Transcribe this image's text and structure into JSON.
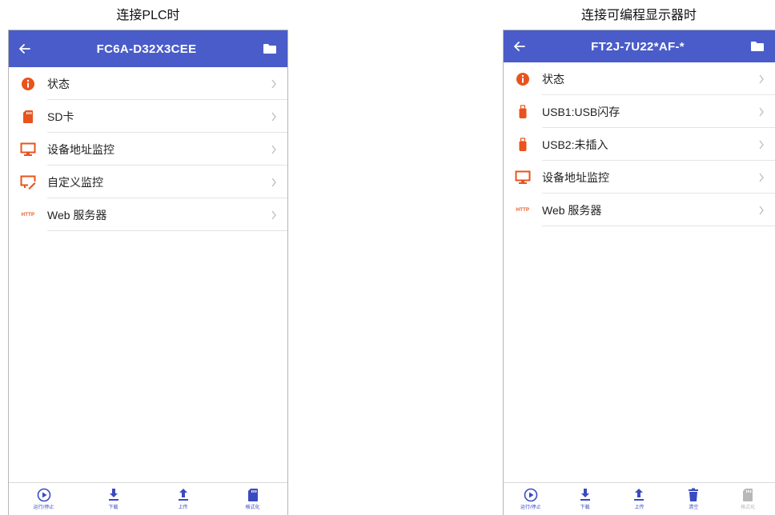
{
  "left": {
    "caption": "连接PLC时",
    "title": "FC6A-D32X3CEE",
    "items": [
      {
        "label": "状态",
        "icon": "info-icon"
      },
      {
        "label": "SD卡",
        "icon": "sd-card-icon"
      },
      {
        "label": "设备地址监控",
        "icon": "monitor-icon"
      },
      {
        "label": "自定义监控",
        "icon": "custom-monitor-icon"
      },
      {
        "label": "Web 服务器",
        "icon": "http-icon",
        "icon_text": "HTTP"
      }
    ],
    "toolbar": [
      {
        "label": "运行/停止",
        "icon": "play-icon"
      },
      {
        "label": "下载",
        "icon": "download-icon"
      },
      {
        "label": "上传",
        "icon": "upload-icon"
      },
      {
        "label": "格式化",
        "icon": "sd-card-icon"
      }
    ]
  },
  "right": {
    "caption": "连接可编程显示器时",
    "title": "FT2J-7U22*AF-*",
    "items": [
      {
        "label": "状态",
        "icon": "info-icon"
      },
      {
        "label": "USB1:USB闪存",
        "icon": "usb-icon"
      },
      {
        "label": "USB2:未插入",
        "icon": "usb-icon"
      },
      {
        "label": "设备地址监控",
        "icon": "monitor-icon"
      },
      {
        "label": "Web 服务器",
        "icon": "http-icon",
        "icon_text": "HTTP"
      }
    ],
    "toolbar": [
      {
        "label": "运行/停止",
        "icon": "play-icon"
      },
      {
        "label": "下载",
        "icon": "download-icon"
      },
      {
        "label": "上传",
        "icon": "upload-icon"
      },
      {
        "label": "清空",
        "icon": "trash-icon"
      },
      {
        "label": "格式化",
        "icon": "sd-card-icon",
        "disabled": true
      }
    ]
  },
  "colors": {
    "header": "#4a5cc9",
    "icon_orange": "#e8531e",
    "toolbar_blue": "#3a4bbf",
    "disabled": "#b8b8b8"
  }
}
